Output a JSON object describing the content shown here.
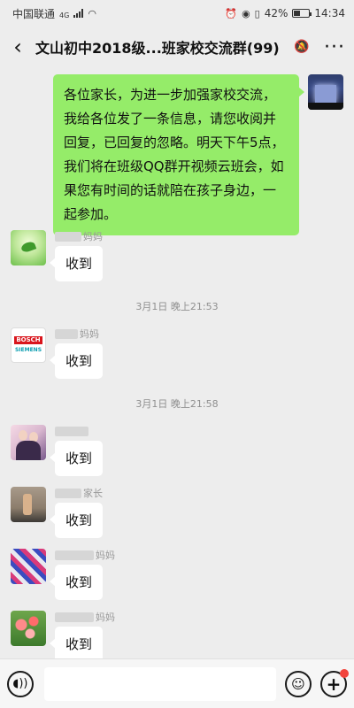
{
  "status_bar": {
    "carrier": "中国联通",
    "network": "4G",
    "battery": "42%",
    "time": "14:34"
  },
  "header": {
    "back_icon": "‹",
    "title": "文山初中2018级...班家校交流群(99)",
    "more_icon": "···"
  },
  "messages": {
    "self": {
      "text": "各位家长，为进一步加强家校交流，我给各位发了一条信息，请您收阅并回复，已回复的忽略。明天下午5点，我们将在班级QQ群开视频云班会，如果您有时间的话就陪在孩子身边，一起参加。"
    },
    "replies": [
      {
        "sender_suffix": "妈妈",
        "text": "收到"
      },
      {
        "sender_suffix": "妈妈",
        "brand_line1": "BOSCH",
        "brand_line2": "SIEMENS",
        "text": "收到"
      },
      {
        "sender_suffix": "",
        "text": "收到"
      },
      {
        "sender_suffix": "家长",
        "text": "收到"
      },
      {
        "sender_suffix": "妈妈",
        "text": "收到"
      },
      {
        "sender_suffix": "妈妈",
        "text": "收到"
      }
    ],
    "timestamps": [
      "3月1日 晚上21:53",
      "3月1日 晚上21:58"
    ]
  },
  "icons": {
    "voice": "voice-icon",
    "emoji": "emoji-icon",
    "plus": "plus-icon",
    "mute": "mute-icon"
  },
  "colors": {
    "self_bubble": "#95ec69",
    "background": "#ededed",
    "badge": "#f2453d"
  }
}
